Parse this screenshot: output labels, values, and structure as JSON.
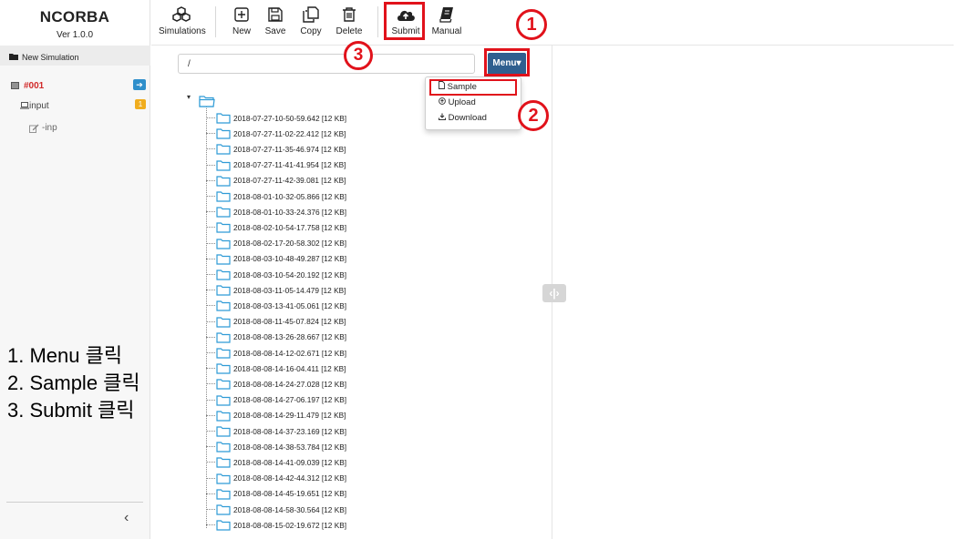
{
  "app": {
    "name": "NCORBA",
    "version": "Ver 1.0.0"
  },
  "toolbar": {
    "items": [
      {
        "label": "Simulations",
        "icon": "cubes-icon"
      },
      {
        "label": "New",
        "icon": "plus-square-icon"
      },
      {
        "label": "Save",
        "icon": "floppy-disk-icon"
      },
      {
        "label": "Copy",
        "icon": "copy-icon"
      },
      {
        "label": "Delete",
        "icon": "trash-icon"
      },
      {
        "label": "Submit",
        "icon": "cloud-upload-icon"
      },
      {
        "label": "Manual",
        "icon": "book-icon"
      }
    ]
  },
  "sidebar": {
    "new_simulation": "New Simulation",
    "simulation": {
      "name": "#001",
      "badge": "➔"
    },
    "input": {
      "name": "input",
      "badge": "1"
    },
    "inp": {
      "name": "-inp"
    },
    "collapse": "‹"
  },
  "main": {
    "path_value": "/",
    "menu_label": "Menu▾",
    "dropdown": [
      {
        "label": "Sample",
        "icon": "file-icon"
      },
      {
        "label": "Upload",
        "icon": "upload-circle-icon"
      },
      {
        "label": "Download",
        "icon": "download-icon"
      }
    ]
  },
  "tree": {
    "nodes": [
      "2018-07-27-10-50-59.642 [12 KB]",
      "2018-07-27-11-02-22.412 [12 KB]",
      "2018-07-27-11-35-46.974 [12 KB]",
      "2018-07-27-11-41-41.954 [12 KB]",
      "2018-07-27-11-42-39.081 [12 KB]",
      "2018-08-01-10-32-05.866 [12 KB]",
      "2018-08-01-10-33-24.376 [12 KB]",
      "2018-08-02-10-54-17.758 [12 KB]",
      "2018-08-02-17-20-58.302 [12 KB]",
      "2018-08-03-10-48-49.287 [12 KB]",
      "2018-08-03-10-54-20.192 [12 KB]",
      "2018-08-03-11-05-14.479 [12 KB]",
      "2018-08-03-13-41-05.061 [12 KB]",
      "2018-08-08-11-45-07.824 [12 KB]",
      "2018-08-08-13-26-28.667 [12 KB]",
      "2018-08-08-14-12-02.671 [12 KB]",
      "2018-08-08-14-16-04.411 [12 KB]",
      "2018-08-08-14-24-27.028 [12 KB]",
      "2018-08-08-14-27-06.197 [12 KB]",
      "2018-08-08-14-29-11.479 [12 KB]",
      "2018-08-08-14-37-23.169 [12 KB]",
      "2018-08-08-14-38-53.784 [12 KB]",
      "2018-08-08-14-41-09.039 [12 KB]",
      "2018-08-08-14-42-44.312 [12 KB]",
      "2018-08-08-14-45-19.651 [12 KB]",
      "2018-08-08-14-58-30.564 [12 KB]",
      "2018-08-08-15-02-19.672 [12 KB]"
    ]
  },
  "annotations": {
    "callouts": [
      "1",
      "2",
      "3"
    ],
    "steps": [
      "1. Menu 클릭",
      "2. Sample 클릭",
      "3. Submit 클릭"
    ],
    "highlight_color": "#e1121b"
  },
  "splitter": {
    "glyph": "‹|›"
  },
  "colors": {
    "menu_button": "#2f5f8f",
    "badge_blue": "#2f8fcb",
    "badge_orange": "#f0ad1e",
    "folder": "#2f9bd6",
    "sim_name": "#d12a2a"
  }
}
